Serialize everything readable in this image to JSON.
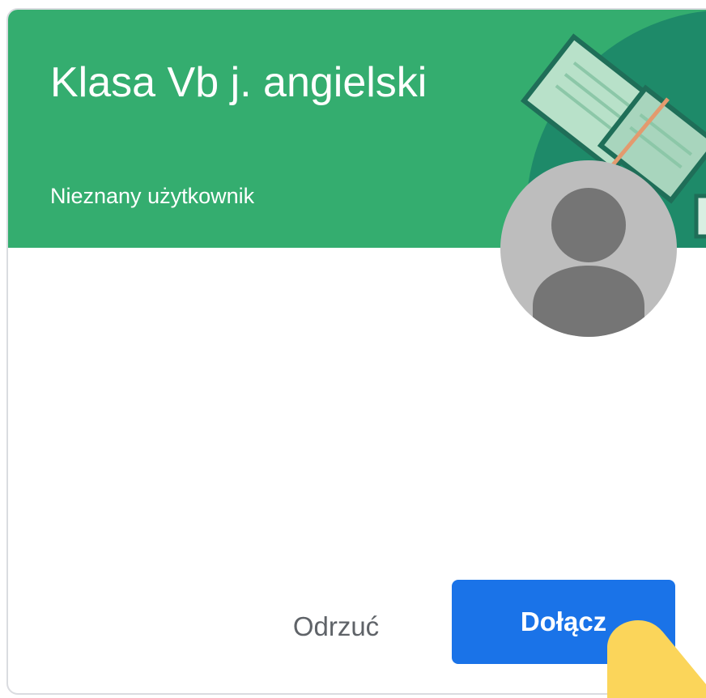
{
  "card": {
    "title": "Klasa Vb j. angielski",
    "subtitle": "Nieznany użytkownik",
    "header_color": "#34ad6f",
    "avatar_icon": "person-silhouette-icon"
  },
  "actions": {
    "reject_label": "Odrzuć",
    "join_label": "Dołącz",
    "join_color": "#1a73e8"
  },
  "decor": {
    "illustration_icon": "book-illustration-icon",
    "pointer_icon": "pointer-highlight-icon",
    "pointer_color": "#fbd55a"
  }
}
